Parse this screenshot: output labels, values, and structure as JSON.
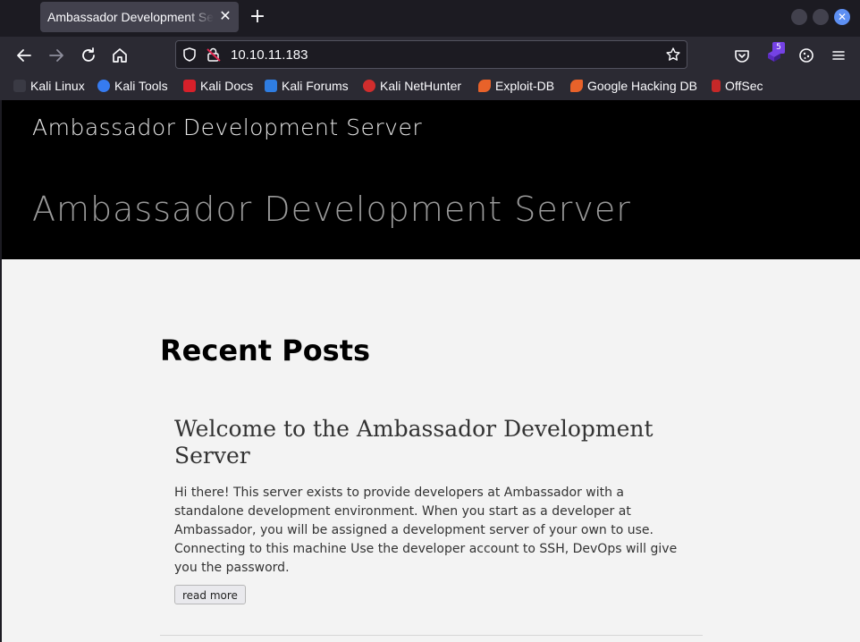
{
  "browser": {
    "tab_title": "Ambassador Development Server",
    "tab_close": "✕",
    "new_tab": "+",
    "url": "10.10.11.183",
    "extension_badge": "5",
    "bookmarks": [
      {
        "label": "Kali Linux",
        "icon": "kali-dragon-icon",
        "color": "#e0e0e0"
      },
      {
        "label": "Kali Tools",
        "icon": "kali-tools-icon",
        "color": "#367bf0"
      },
      {
        "label": "Kali Docs",
        "icon": "kali-docs-icon",
        "color": "#d7202a"
      },
      {
        "label": "Kali Forums",
        "icon": "kali-forums-icon",
        "color": "#2f7de1"
      },
      {
        "label": "Kali NetHunter",
        "icon": "kali-nethunter-icon",
        "color": "#d12d2d"
      },
      {
        "label": "Exploit-DB",
        "icon": "exploit-db-icon",
        "color": "#e8622a"
      },
      {
        "label": "Google Hacking DB",
        "icon": "ghdb-icon",
        "color": "#e8622a"
      },
      {
        "label": "OffSec",
        "icon": "offsec-icon",
        "color": "#c62828"
      }
    ]
  },
  "page": {
    "site_title": "Ambassador Development Server",
    "hero_title": "Ambassador Development Server",
    "section_title": "Recent Posts",
    "posts": [
      {
        "title": "Welcome to the Ambassador Development Server",
        "body": "Hi there! This server exists to provide developers at Ambassador with a standalone development environment. When you start as a developer at Ambassador, you will be assigned a development server of your own to use. Connecting to this machine Use the developer account to SSH, DevOps will give you the password.",
        "read_more": "read more"
      }
    ]
  }
}
